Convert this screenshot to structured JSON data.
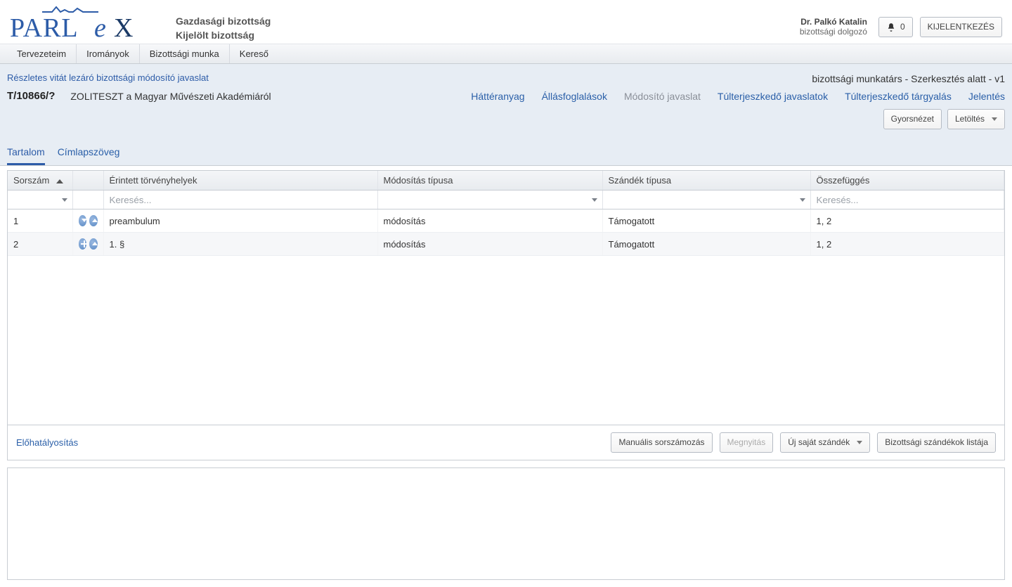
{
  "header": {
    "title1": "Gazdasági bizottság",
    "title2": "Kijelölt bizottság",
    "user_name": "Dr. Palkó Katalin",
    "user_role": "bizottsági dolgozó",
    "notif_count": "0",
    "logout": "KIJELENTKEZÉS"
  },
  "nav": {
    "items": [
      "Tervezeteim",
      "Irományok",
      "Bizottsági munka",
      "Kereső"
    ]
  },
  "breadcrumb": "Részletes vitát lezáró bizottsági módosító javaslat",
  "status": "bizottsági munkatárs - Szerkesztés alatt - v1",
  "doc": {
    "id": "T/10866/?",
    "title": "ZOLITESZT a Magyar Művészeti Akadémiáról"
  },
  "sublinks": {
    "hatteranyag": "Háttéranyag",
    "allasfog": "Állásfoglalások",
    "modosito": "Módosító javaslat",
    "tulterj_jav": "Túlterjeszkedő javaslatok",
    "tulterj_targy": "Túlterjeszkedő tárgyalás",
    "jelentes": "Jelentés"
  },
  "toolbar": {
    "gyorsnezet": "Gyorsnézet",
    "letoltes": "Letöltés"
  },
  "tabs": {
    "tartalom": "Tartalom",
    "cimlap": "Címlapszöveg"
  },
  "columns": {
    "sorszam": "Sorszám",
    "erintett": "Érintett törvényhelyek",
    "modositas": "Módosítás típusa",
    "szandek": "Szándék típusa",
    "osszefugges": "Összefüggés"
  },
  "filters": {
    "search_placeholder": "Keresés..."
  },
  "rows": [
    {
      "sorszam": "1",
      "erintett": "preambulum",
      "mod": "módosítás",
      "szandek": "Támogatott",
      "ossz": "1, 2"
    },
    {
      "sorszam": "2",
      "erintett": "1. §",
      "mod": "módosítás",
      "szandek": "Támogatott",
      "ossz": "1, 2"
    }
  ],
  "actions": {
    "elohat": "Előhatályosítás",
    "manual": "Manuális sorszámozás",
    "megnyitas": "Megnyitás",
    "ujsajat": "Új saját szándék",
    "bizszandek": "Bizottsági szándékok listája"
  }
}
